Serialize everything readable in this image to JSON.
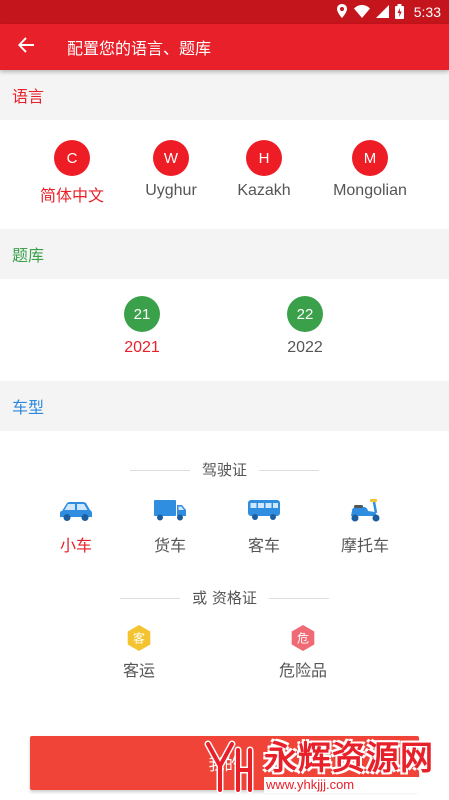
{
  "status_bar": {
    "time": "5:33"
  },
  "app_bar": {
    "title": "配置您的语言、题库"
  },
  "sections": {
    "language": "语言",
    "question_bank": "题库",
    "vehicle_type": "车型"
  },
  "languages": [
    {
      "letter": "C",
      "label": "简体中文",
      "selected": true
    },
    {
      "letter": "W",
      "label": "Uyghur",
      "selected": false
    },
    {
      "letter": "H",
      "label": "Kazakh",
      "selected": false
    },
    {
      "letter": "M",
      "label": "Mongolian",
      "selected": false
    }
  ],
  "question_banks": [
    {
      "badge": "21",
      "label": "2021",
      "selected": true
    },
    {
      "badge": "22",
      "label": "2022",
      "selected": false
    }
  ],
  "license_title": "驾驶证",
  "vehicles": [
    {
      "label": "小车",
      "icon": "car-icon",
      "selected": true
    },
    {
      "label": "货车",
      "icon": "truck-icon",
      "selected": false
    },
    {
      "label": "客车",
      "icon": "bus-icon",
      "selected": false
    },
    {
      "label": "摩托车",
      "icon": "scooter-icon",
      "selected": false
    }
  ],
  "qualification_title": "或 资格证",
  "qualifications": [
    {
      "badge": "客",
      "label": "客运",
      "color": "#f4c430"
    },
    {
      "badge": "危",
      "label": "危险品",
      "color": "#f06a75"
    }
  ],
  "confirm_button": {
    "label": "我的"
  },
  "watermark": {
    "name": "永辉资源网",
    "url": "www.yhkjjj.com"
  },
  "colors": {
    "primary": "#e8202a",
    "green": "#3aa14a",
    "blue": "#2b8ae0",
    "button": "#f04438"
  }
}
